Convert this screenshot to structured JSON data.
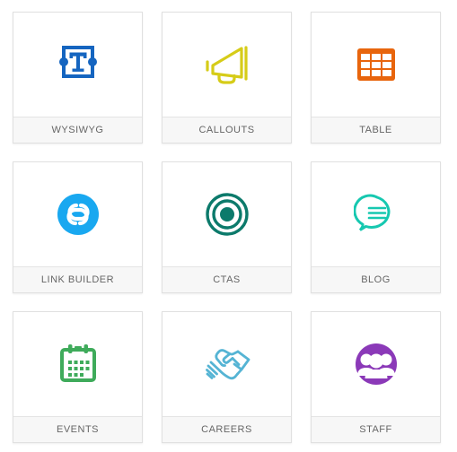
{
  "grid": {
    "rows": [
      {
        "cards": [
          {
            "label": "WYSIWYG",
            "icon": "wysiwyg-text-icon",
            "color": "#1565c0"
          },
          {
            "label": "CALLOUTS",
            "icon": "megaphone-icon",
            "color": "#d6cc18"
          },
          {
            "label": "TABLE",
            "icon": "table-grid-icon",
            "color": "#e8650d"
          }
        ]
      },
      {
        "cards": [
          {
            "label": "LINK BUILDER",
            "icon": "chain-link-icon",
            "color": "#19a8f0"
          },
          {
            "label": "CTAS",
            "icon": "bullseye-target-icon",
            "color": "#0c7a6b"
          },
          {
            "label": "BLOG",
            "icon": "speech-bubble-icon",
            "color": "#16c8b0"
          }
        ]
      },
      {
        "cards": [
          {
            "label": "EVENTS",
            "icon": "calendar-icon",
            "color": "#3fab5b"
          },
          {
            "label": "CAREERS",
            "icon": "handshake-icon",
            "color": "#55b4d4"
          },
          {
            "label": "STAFF",
            "icon": "group-people-icon",
            "color": "#8b39b8"
          }
        ]
      }
    ]
  }
}
